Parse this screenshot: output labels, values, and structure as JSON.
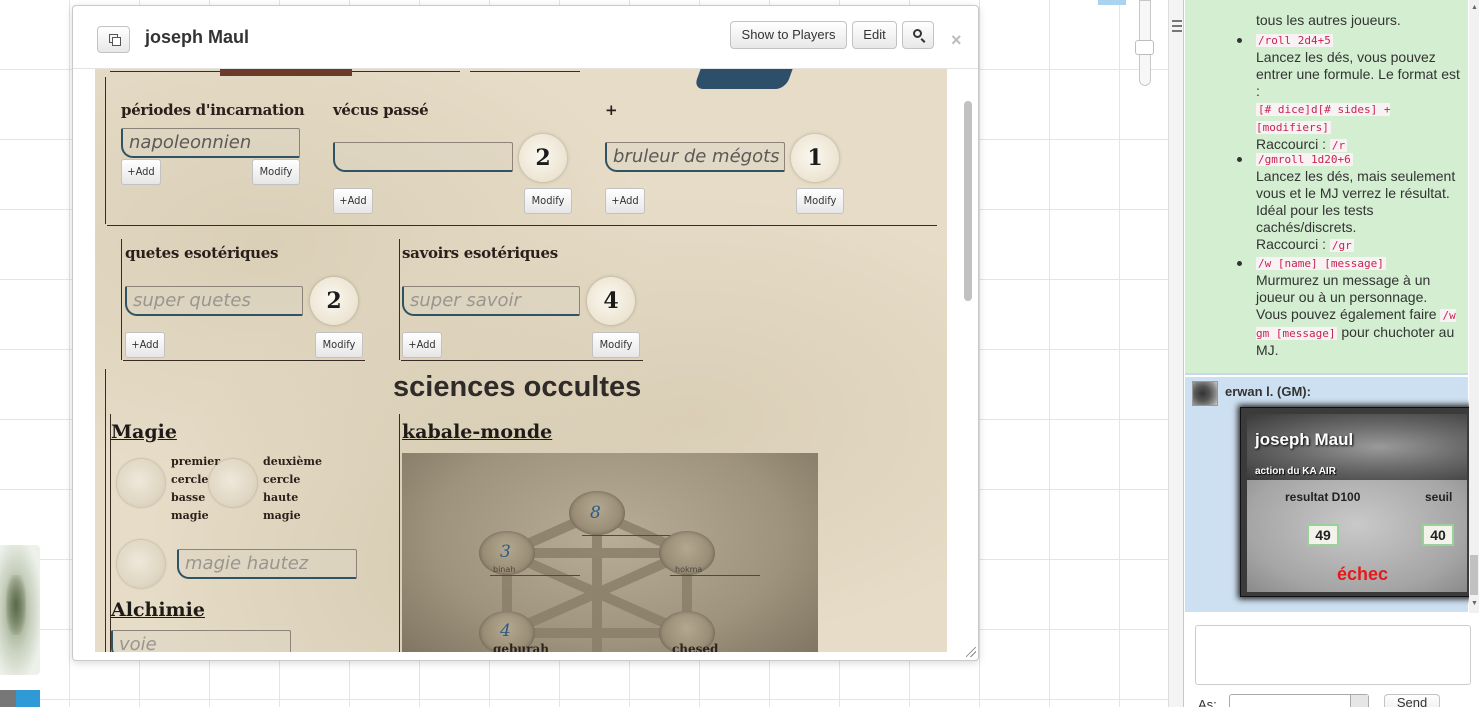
{
  "dialog": {
    "title": "joseph Maul",
    "show_to_players": "Show to Players",
    "edit": "Edit",
    "close": "×"
  },
  "sheet": {
    "incarnation": {
      "label": "périodes d'incarnation",
      "value": "napoleonnien",
      "add": "+Add",
      "modify": "Modify"
    },
    "vecus": {
      "label": "vécus passé",
      "value": "",
      "circle": "2",
      "add": "+Add",
      "modify": "Modify"
    },
    "plus": {
      "label": "+",
      "value": "bruleur de mégots",
      "circle": "1",
      "add": "+Add",
      "modify": "Modify"
    },
    "quetes": {
      "label": "quetes esotériques",
      "placeholder": "super quetes",
      "circle": "2",
      "add": "+Add",
      "modify": "Modify"
    },
    "savoirs": {
      "label": "savoirs esotériques",
      "placeholder": "super savoir",
      "circle": "4",
      "add": "+Add",
      "modify": "Modify"
    },
    "sciences_title": "sciences occultes",
    "magie": {
      "title": "Magie",
      "first_circle": [
        "premier",
        "cercle",
        "basse",
        "magie"
      ],
      "second_circle": [
        "deuxième",
        "cercle",
        "haute",
        "magie"
      ],
      "haute_placeholder": "magie hautez"
    },
    "alchimie": {
      "title": "Alchimie",
      "voie_placeholder": "voie"
    },
    "kabale": {
      "title": "kabale-monde",
      "nodes": [
        {
          "num": "8",
          "word": "",
          "sub": ""
        },
        {
          "num": "3",
          "word": "",
          "sub": "binah"
        },
        {
          "num": "",
          "word": "",
          "sub": "hokma"
        },
        {
          "num": "4",
          "word": "geburah",
          "sub": ""
        },
        {
          "num": "",
          "word": "chesed",
          "sub": ""
        }
      ]
    }
  },
  "chat": {
    "help": {
      "tail": "tous les autres joueurs.",
      "items": [
        {
          "cmd": "/roll 2d4+5",
          "text": "Lancez les dés, vous pouvez entrer une formule. Le format est :",
          "format": "[# dice]d[# sides] + [modifiers]",
          "shortcut_label": "Raccourci :",
          "shortcut": "/r"
        },
        {
          "cmd": "/gmroll 1d20+6",
          "text": "Lancez les dés, mais seulement vous et le MJ verrez le résultat. Idéal pour les tests cachés/discrets.",
          "shortcut_label": "Raccourci :",
          "shortcut": "/gr"
        },
        {
          "cmd": "/w [name] [message]",
          "text1": "Murmurez un message à un joueur ou à un personnage. Vous pouvez également faire",
          "code": "/w gm [message]",
          "text2": "pour chuchoter au MJ."
        }
      ]
    },
    "message": {
      "author": "erwan l. (GM):",
      "roll": {
        "name": "joseph Maul",
        "subtitle": "action du KA AIR",
        "col1": "resultat D100",
        "col2": "seuil",
        "val1": "49",
        "val2": "40",
        "result": "échec"
      }
    },
    "as_label": "As:",
    "send": "Send"
  }
}
